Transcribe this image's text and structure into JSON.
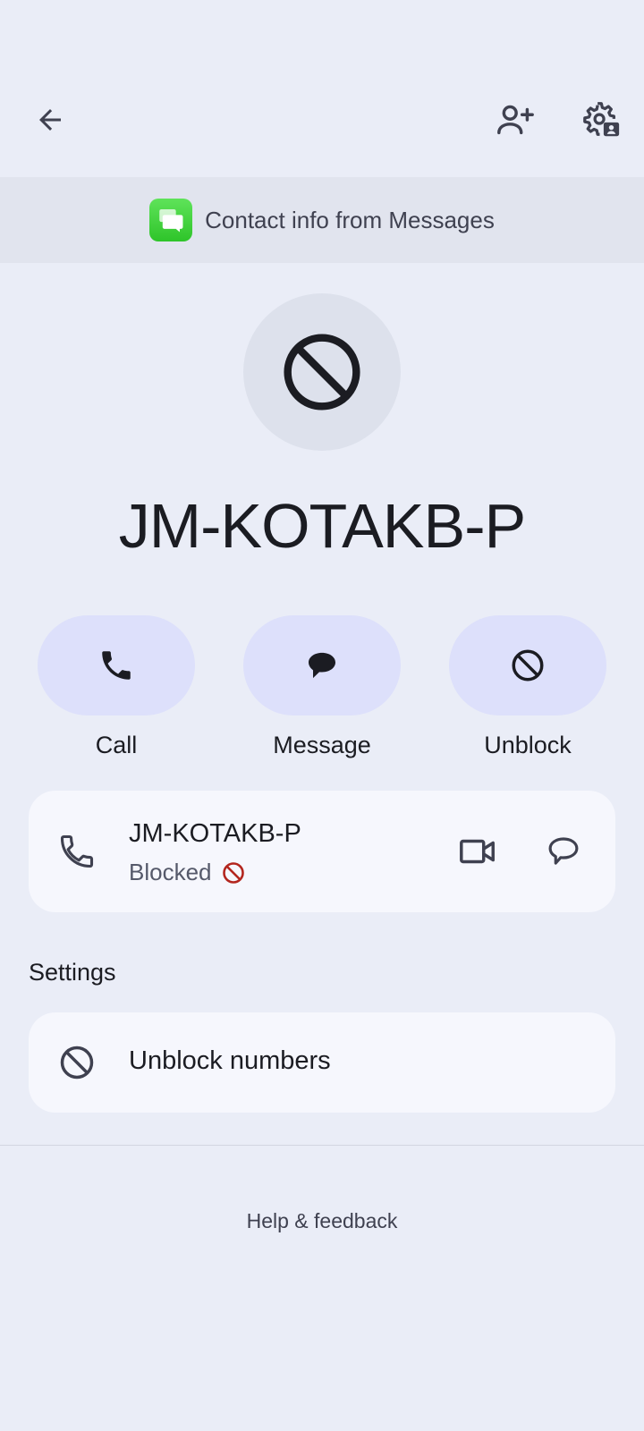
{
  "toolbar": {
    "back_icon": "arrow-back-icon",
    "add_contact_icon": "person-add-icon",
    "settings_icon": "contact-settings-icon"
  },
  "banner": {
    "icon": "messages-app-icon",
    "text": "Contact info from Messages"
  },
  "contact": {
    "avatar_icon": "block-icon",
    "name": "JM-KOTAKB-P"
  },
  "actions": [
    {
      "label": "Call",
      "icon": "phone-icon"
    },
    {
      "label": "Message",
      "icon": "message-icon"
    },
    {
      "label": "Unblock",
      "icon": "block-icon"
    }
  ],
  "number_card": {
    "number": "JM-KOTAKB-P",
    "status": "Blocked",
    "status_icon": "blocked-badge-icon",
    "status_color": "#b3261e",
    "video_icon": "videocam-icon",
    "message_icon": "chat-bubble-outline-icon"
  },
  "settings": {
    "title": "Settings",
    "items": [
      {
        "label": "Unblock numbers",
        "icon": "block-icon"
      }
    ]
  },
  "footer": {
    "help_label": "Help & feedback"
  },
  "colors": {
    "background": "#eaedf7",
    "action_pill": "#dde0fb",
    "card": "#f6f7fd",
    "banner": "#e1e4ee"
  }
}
